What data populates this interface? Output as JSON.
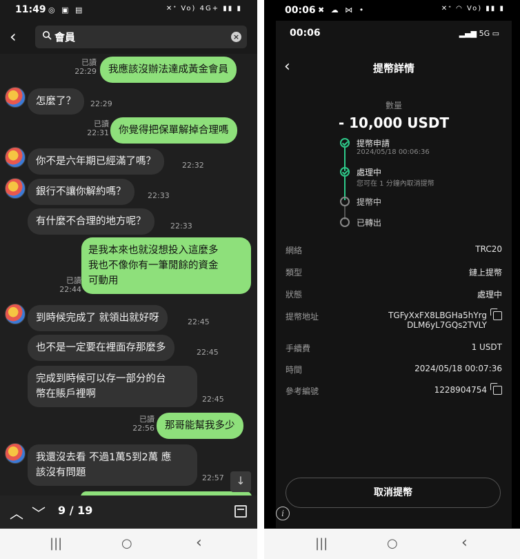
{
  "left_phone": {
    "status": {
      "time": "11:49",
      "left_icons": "◎ ▣ ▤",
      "right_icons": "✕ᐩ Vo) 4G+ ▮▮ ▮"
    },
    "search": {
      "query": "會員",
      "clear": "×"
    },
    "messages": [
      {
        "side": "out",
        "text": "我應該沒辦法達成黃金會員",
        "read": "已讀",
        "time": "22:29"
      },
      {
        "side": "in",
        "text": "怎麼了？",
        "time": "22:29"
      },
      {
        "side": "out",
        "text": "你覺得把保單解掉合理嗎",
        "read": "已讀",
        "time": "22:31"
      },
      {
        "side": "in",
        "text": "你不是六年期已經滿了嗎？",
        "time": "22:32"
      },
      {
        "side": "in",
        "text": "銀行不讓你解約嗎？",
        "time": "22:33"
      },
      {
        "side": "in",
        "text": "有什麼不合理的地方呢？",
        "time": "22:33"
      },
      {
        "side": "out",
        "text": "是我本來也就沒想投入這麼多我也不像你有一筆閒餘的資金可動用",
        "lines": [
          "是我本來也就沒想投入這麼多",
          "我也不像你有一筆閒餘的資金",
          "可動用"
        ],
        "read": "已讀",
        "time": "22:44"
      },
      {
        "side": "in",
        "text": "到時候完成了 就領出就好呀",
        "time": "22:45"
      },
      {
        "side": "in",
        "text": "也不是一定要在裡面存那麼多",
        "time": "22:45"
      },
      {
        "side": "in",
        "text": "完成到時候可以存一部分的台幣在賬戶裡啊",
        "lines": [
          "完成到時候可以存一部分的台",
          "幣在賬戶裡啊"
        ],
        "time": "22:45"
      },
      {
        "side": "out",
        "text": "那哥能幫我多少",
        "read": "已讀",
        "time": "22:56"
      },
      {
        "side": "in",
        "text": "我還沒去看  不過1萬5到2萬 應該沒有問題",
        "lines": [
          "我還沒去看  不過1萬5到2萬 應",
          "該沒有問題"
        ],
        "time": "22:57"
      }
    ],
    "result_counter": "9 / 19"
  },
  "right_phone": {
    "status": {
      "time": "00:06",
      "left_icons": "✖ ☁ ⋈ •",
      "right_icons": "✕ᐩ ◠ Vo) ▮▮ ▮"
    },
    "inner_status": {
      "time": "00:06",
      "network": "5G"
    },
    "title": "提幣詳情",
    "amount_label": "數量",
    "amount": "- 10,000 USDT",
    "steps": [
      {
        "label": "提幣申請",
        "sub": "2024/05/18 00:06:36",
        "done": true
      },
      {
        "label": "處理中",
        "sub": "您可在 1 分鐘內取消提幣",
        "done": true
      },
      {
        "label": "提幣中",
        "sub": "",
        "done": false
      },
      {
        "label": "已轉出",
        "sub": "",
        "done": false
      }
    ],
    "details": {
      "network_label": "網絡",
      "network_value": "TRC20",
      "type_label": "類型",
      "type_value": "鏈上提幣",
      "status_label": "狀態",
      "status_value": "處理中",
      "address_label": "提幣地址",
      "address_line1": "TGFyXxFX8LBGHa5hYrg",
      "address_line2": "DLM6yL7GQs2TVLY",
      "fee_label": "手續費",
      "fee_value": "1 USDT",
      "time_label": "時間",
      "time_value": "2024/05/18 00:07:36",
      "ref_label": "參考編號",
      "ref_value": "1228904754"
    },
    "cancel_button": "取消提幣",
    "info_glyph": "i"
  },
  "system_nav": {
    "recents": "|||",
    "home": "○",
    "back": "‹"
  },
  "colors": {
    "out_bubble": "#8ee07b",
    "in_bubble": "#333333",
    "check_green": "#2ecc8b"
  }
}
